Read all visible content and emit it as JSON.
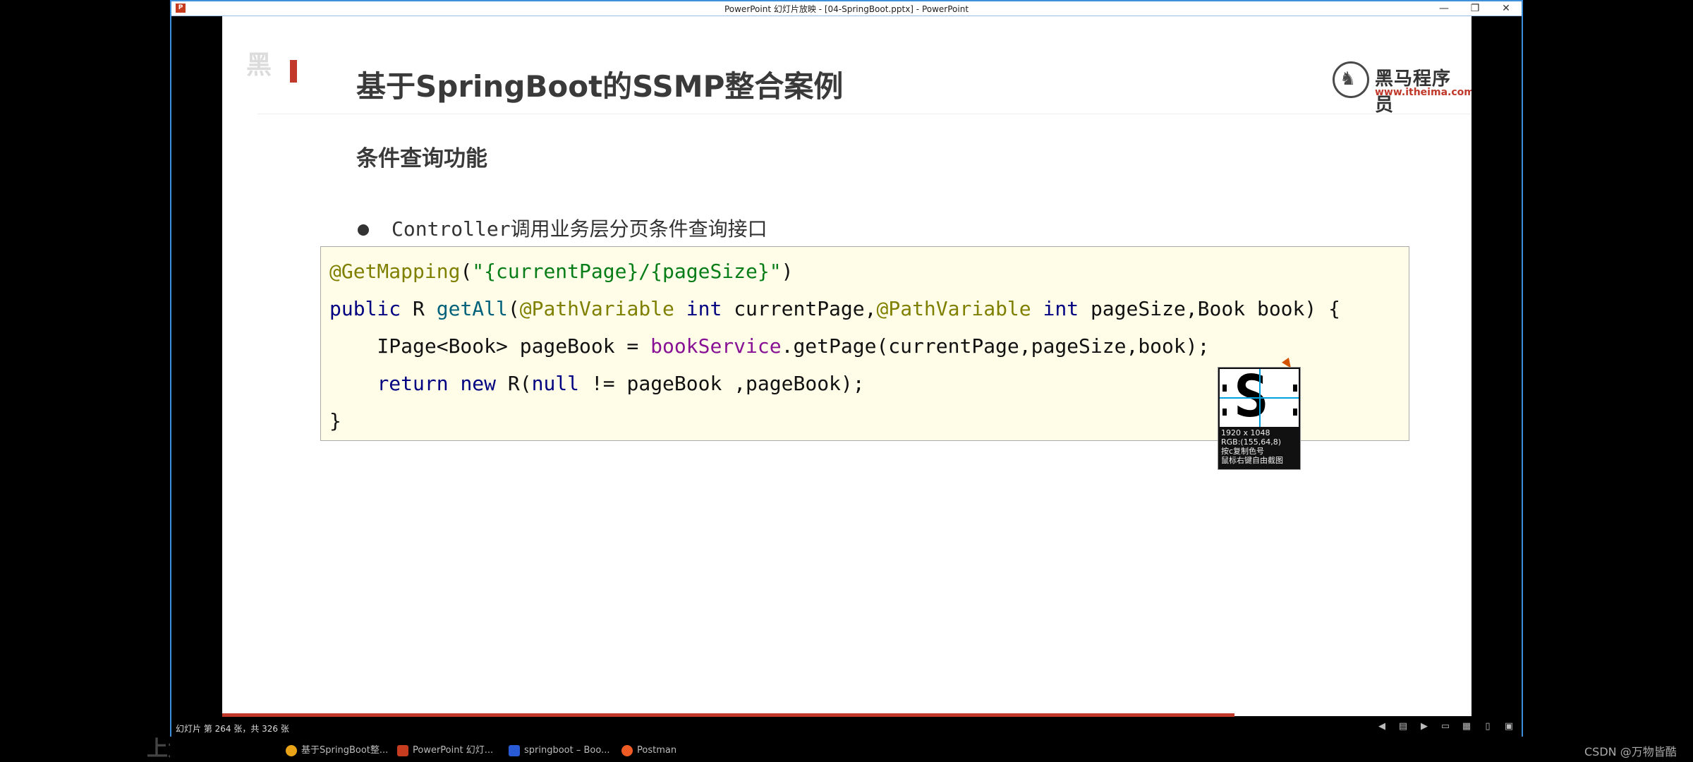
{
  "window": {
    "title": "PowerPoint 幻灯片放映 - [04-SpringBoot.pptx] - PowerPoint",
    "app_icon": "P",
    "minimize": "—",
    "restore": "❐",
    "close": "✕"
  },
  "slide": {
    "watermark": "黑",
    "title": "基于SpringBoot的SSMP整合案例",
    "logo_cn": "黑马程序员",
    "logo_url": "www.itheima.com",
    "subtitle": "条件查询功能",
    "bullet": "Controller调用业务层分页条件查询接口",
    "code": {
      "l1_anno": "@GetMapping",
      "l1_open": "(",
      "l1_str": "\"{currentPage}/{pageSize}\"",
      "l1_close": ")",
      "l2_kw1": "public",
      "l2_t1": " R ",
      "l2_fn": "getAll",
      "l2_p1": "(",
      "l2_anno1": "@PathVariable",
      "l2_sp1": " ",
      "l2_kw2": "int",
      "l2_t2": " currentPage,",
      "l2_anno2": "@PathVariable",
      "l2_sp2": " ",
      "l2_kw3": "int",
      "l2_t3": " pageSize,Book book) {",
      "l3_t1": "    IPage<Book> pageBook = ",
      "l3_fld": "bookService",
      "l3_t2": ".getPage(currentPage,pageSize,book);",
      "l4_ind": "    ",
      "l4_kw1": "return",
      "l4_sp": " ",
      "l4_kw2": "new",
      "l4_t1": " R(",
      "l4_kw3": "null",
      "l4_t2": " != pageBook ,pageBook);",
      "l5": "}"
    },
    "progress": 0.81
  },
  "magnifier": {
    "resolution": "1920 x 1048",
    "rgb": "RGB:(155,64,8)",
    "hint1": "按c复制色号",
    "hint2": "鼠标右键自由截图"
  },
  "statusbar": {
    "slide_info": "幻灯片 第 264 张，共 326 张",
    "icons": [
      "prev-icon",
      "menu-icon",
      "next-icon",
      "normal-view-icon",
      "sorter-view-icon",
      "reading-view-icon",
      "slideshow-icon"
    ]
  },
  "taskbar": {
    "items": [
      "基于SpringBoot整...",
      "PowerPoint 幻灯...",
      "springboot – Boo...",
      "Postman"
    ]
  },
  "overlay": "上大正在看",
  "footer": "CSDN @万物皆酷"
}
